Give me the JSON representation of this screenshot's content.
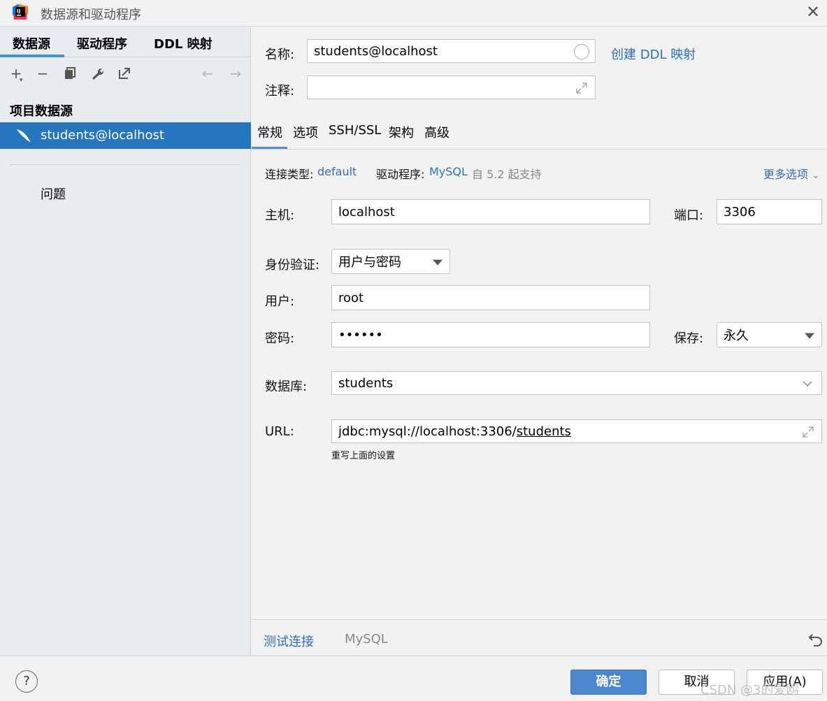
{
  "window": {
    "title": "数据源和驱动程序"
  },
  "left": {
    "tabs": [
      "数据源",
      "驱动程序",
      "DDL 映射"
    ],
    "section_title": "项目数据源",
    "datasource": "students@localhost",
    "problems": "问题"
  },
  "form": {
    "name_label": "名称:",
    "name_value": "students@localhost",
    "create_ddl": "创建 DDL 映射",
    "comment_label": "注释:",
    "comment_value": ""
  },
  "tabs": [
    "常规",
    "选项",
    "SSH/SSL",
    "架构",
    "高级"
  ],
  "general": {
    "conn_type_label": "连接类型:",
    "conn_type_value": "default",
    "driver_label": "驱动程序:",
    "driver_value": "MySQL",
    "driver_note": "自 5.2 起支持",
    "more_options": "更多选项",
    "host_label": "主机:",
    "host_value": "localhost",
    "port_label": "端口:",
    "port_value": "3306",
    "auth_label": "身份验证:",
    "auth_value": "用户与密码",
    "user_label": "用户:",
    "user_value": "root",
    "password_label": "密码:",
    "password_value": "••••••",
    "save_label": "保存:",
    "save_value": "永久",
    "database_label": "数据库:",
    "database_value": "students",
    "url_label": "URL:",
    "url_prefix": "jdbc:mysql://localhost:3306/",
    "url_db": "students",
    "url_hint": "重写上面的设置"
  },
  "bottom": {
    "test_connection": "测试连接",
    "driver": "MySQL"
  },
  "footer": {
    "help": "?",
    "ok": "确定",
    "cancel": "取消",
    "apply": "应用(A)",
    "watermark": "CSDN @3的爱鸥"
  },
  "colors": {
    "accent": "#2675bf",
    "link": "#2f6fb8",
    "primary_button": "#4a87cf"
  }
}
